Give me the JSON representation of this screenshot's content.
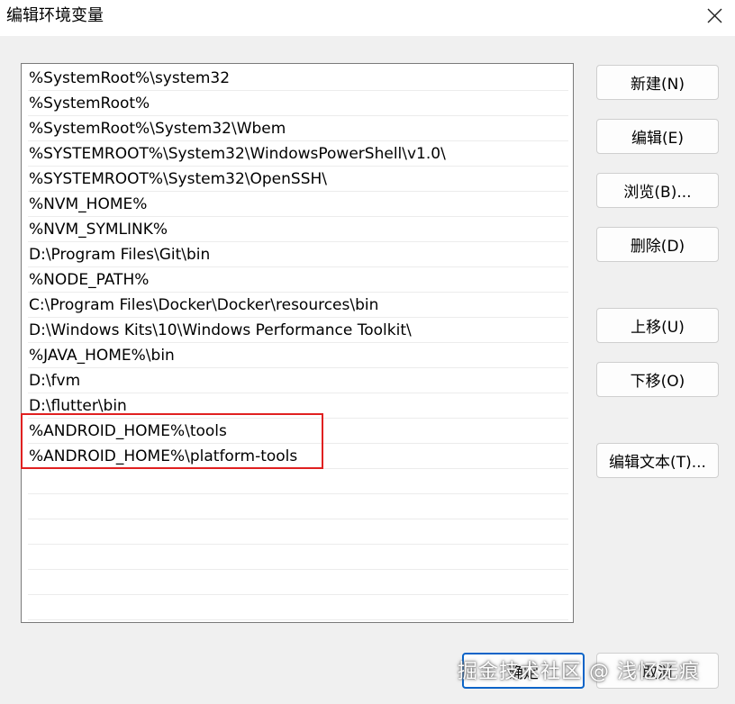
{
  "window": {
    "title": "编辑环境变量",
    "close_icon": "close-icon"
  },
  "path_list": {
    "items": [
      "%SystemRoot%\\system32",
      "%SystemRoot%",
      "%SystemRoot%\\System32\\Wbem",
      "%SYSTEMROOT%\\System32\\WindowsPowerShell\\v1.0\\",
      "%SYSTEMROOT%\\System32\\OpenSSH\\",
      "%NVM_HOME%",
      "%NVM_SYMLINK%",
      "D:\\Program Files\\Git\\bin",
      "%NODE_PATH%",
      "C:\\Program Files\\Docker\\Docker\\resources\\bin",
      "D:\\Windows Kits\\10\\Windows Performance Toolkit\\",
      "%JAVA_HOME%\\bin",
      "D:\\fvm",
      "D:\\flutter\\bin",
      "%ANDROID_HOME%\\tools",
      "%ANDROID_HOME%\\platform-tools"
    ],
    "highlight_color": "#e02020"
  },
  "buttons": {
    "new": "新建(N)",
    "edit": "编辑(E)",
    "browse": "浏览(B)...",
    "delete": "删除(D)",
    "move_up": "上移(U)",
    "move_down": "下移(O)",
    "edit_text": "编辑文本(T)...",
    "ok": "确定",
    "cancel": "取消"
  },
  "watermark": "掘金技术社区 @ 浅忆无痕"
}
